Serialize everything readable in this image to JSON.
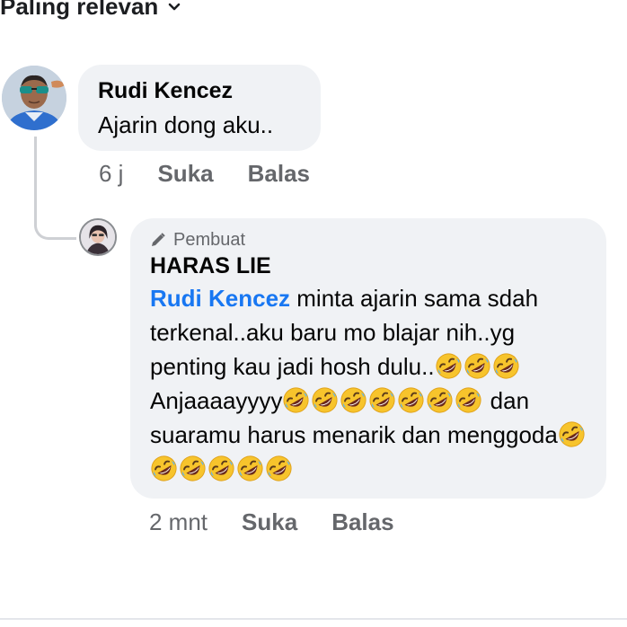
{
  "sort": {
    "label": "Paling relevan",
    "icon": "chevron-down-icon"
  },
  "comments": [
    {
      "author": "Rudi Kencez",
      "text": "Ajarin dong aku..",
      "time": "6 j",
      "like_label": "Suka",
      "reply_label": "Balas"
    }
  ],
  "reply": {
    "badge_label": "Pembuat",
    "badge_icon": "pencil-icon",
    "author": "HARAS LIE",
    "mention": "Rudi Kencez",
    "text_1": " minta ajarin sama sdah terkenal..aku baru mo blajar nih..yg penting kau jadi hosh dulu..",
    "text_2": "Anjaaaayyyy",
    "text_3": " dan suaramu harus menarik dan menggoda",
    "time": "2 mnt",
    "like_label": "Suka",
    "reply_label": "Balas"
  },
  "colors": {
    "bubble": "#f0f2f5",
    "mention": "#1877f2",
    "meta": "#65676b"
  }
}
